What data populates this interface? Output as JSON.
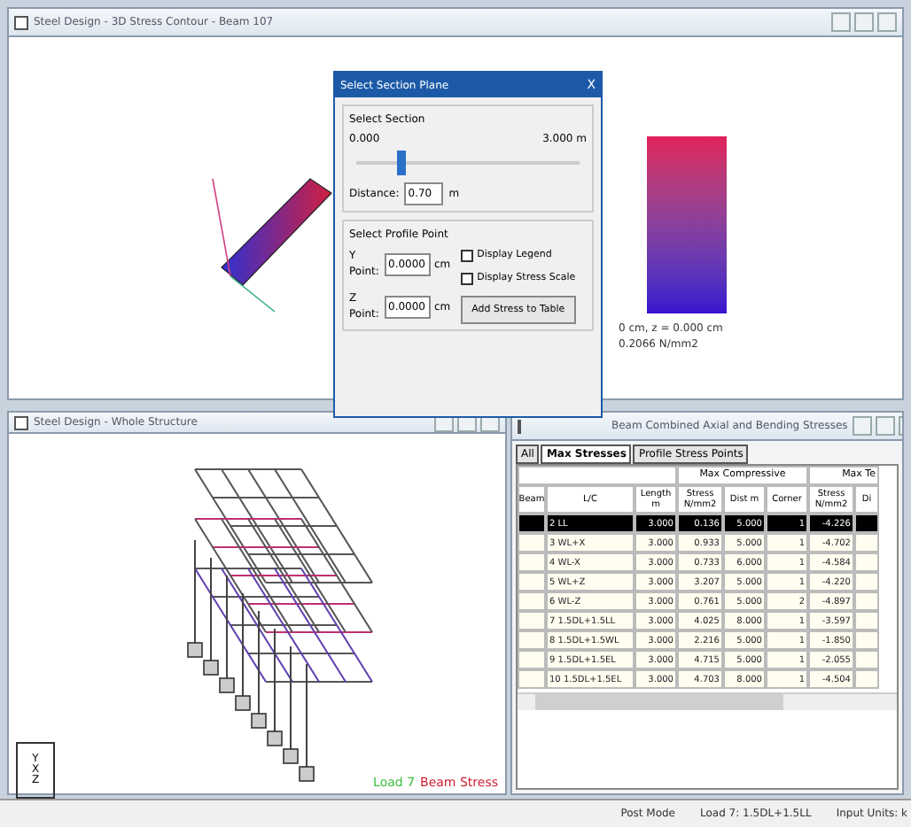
{
  "top_window": {
    "title": "Steel Design - 3D Stress Contour - Beam 107",
    "readout": [
      "0 cm, z = 0.000 cm",
      "0.2066 N/mm2"
    ]
  },
  "dialog": {
    "title": "Select Section Plane",
    "close": "X",
    "section_group": "Select Section",
    "range_start": "0.000",
    "range_end": "3.000 m",
    "slider": {
      "level": 0.2
    },
    "distance_label": "Distance:",
    "distance_value": "0.70",
    "distance_unit": "m",
    "profile_group": "Select Profile Point",
    "y_label": "Y Point:",
    "y_value": "0.0000",
    "y_unit": "cm",
    "z_label": "Z Point:",
    "z_value": "0.0000",
    "z_unit": "cm",
    "checkboxes": [
      {
        "label": "Display Legend",
        "checked": false
      },
      {
        "label": "Display Stress Scale",
        "checked": false
      }
    ],
    "button": "Add Stress to Table"
  },
  "structure_window": {
    "title": "Steel Design - Whole Structure",
    "load_label": "Load 7",
    "mode_label": "Beam Stress",
    "axes": [
      "Y",
      "X",
      "Z"
    ]
  },
  "table_window": {
    "title": "Beam Combined Axial and Bending Stresses",
    "tabs": [
      {
        "label": "All",
        "selected": false
      },
      {
        "label": "Max Stresses",
        "selected": true
      },
      {
        "label": "Profile Stress Points",
        "selected": false
      }
    ],
    "group_headers": [
      "Max Compressive",
      "Max Te"
    ],
    "columns": [
      "Beam",
      "L/C",
      "Length m",
      "Stress N/mm2",
      "Dist m",
      "Corner",
      "Stress N/mm2",
      "Di"
    ],
    "rows": [
      {
        "selected": true,
        "cells": [
          "",
          "2 LL",
          "3.000",
          "0.136",
          "5.000",
          "1",
          "-4.226"
        ]
      },
      {
        "selected": false,
        "cells": [
          "",
          "3 WL+X",
          "3.000",
          "0.933",
          "5.000",
          "1",
          "-4.702"
        ]
      },
      {
        "selected": false,
        "cells": [
          "",
          "4 WL-X",
          "3.000",
          "0.733",
          "6.000",
          "1",
          "-4.584"
        ]
      },
      {
        "selected": false,
        "cells": [
          "",
          "5 WL+Z",
          "3.000",
          "3.207",
          "5.000",
          "1",
          "-4.220"
        ]
      },
      {
        "selected": false,
        "cells": [
          "",
          "6 WL-Z",
          "3.000",
          "0.761",
          "5.000",
          "2",
          "-4.897"
        ]
      },
      {
        "selected": false,
        "cells": [
          "",
          "7 1.5DL+1.5LL",
          "3.000",
          "4.025",
          "8.000",
          "1",
          "-3.597"
        ]
      },
      {
        "selected": false,
        "cells": [
          "",
          "8 1.5DL+1.5WL",
          "3.000",
          "2.216",
          "5.000",
          "1",
          "-1.850"
        ]
      },
      {
        "selected": false,
        "cells": [
          "",
          "9 1.5DL+1.5EL",
          "3.000",
          "4.715",
          "5.000",
          "1",
          "-2.055"
        ]
      },
      {
        "selected": false,
        "cells": [
          "",
          "10 1.5DL+1.5EL",
          "3.000",
          "4.703",
          "8.000",
          "1",
          "-4.504"
        ]
      }
    ]
  },
  "status_bar": [
    "Post Mode",
    "Load 7: 1.5DL+1.5LL",
    "Input Units: k"
  ]
}
